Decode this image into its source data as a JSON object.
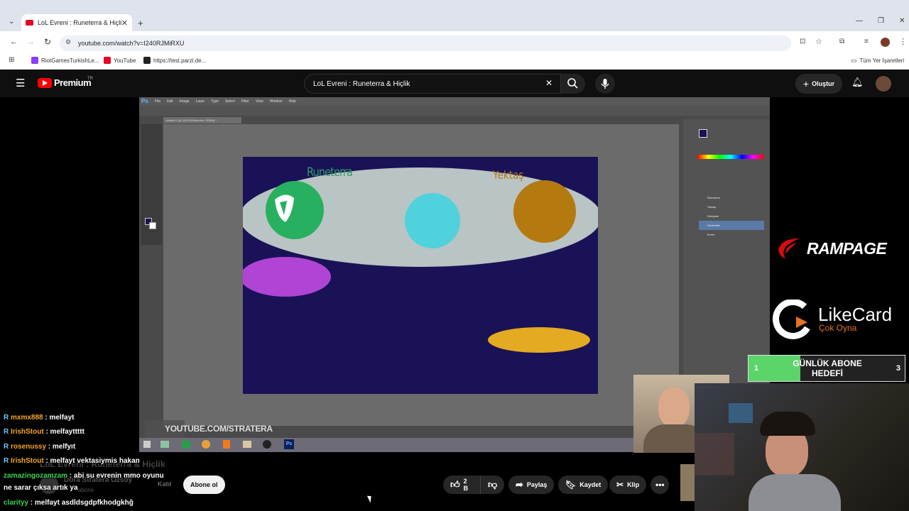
{
  "browser": {
    "tab_title": "LoL Evreni : Runeterra & Hiçlik",
    "url": "youtube.com/watch?v=I240RJMiRXU",
    "bookmarks": [
      "RiotGamesTurkishLe...",
      "YouTube",
      "https://test.parzi.de..."
    ],
    "all_bookmarks_label": "Tüm Yer İşaretleri"
  },
  "youtube": {
    "logo_text": "Premium",
    "region": "TR",
    "search_value": "LoL Evreni : Runeterra & Hiçlik",
    "create_label": "Oluştur"
  },
  "video": {
    "canvas_labels": {
      "runeterra": "Runeterra",
      "yektas": "Yektaş"
    },
    "watermark": "YOUTUBE.COM/STRATERA",
    "ps_menu": [
      "File",
      "Edit",
      "Image",
      "Layer",
      "Type",
      "Select",
      "Filter",
      "View",
      "Window",
      "Help"
    ],
    "ps_doc_tab": "Untitled-1 @ 100% (Düzlemler, RGB/8) *",
    "ps_layers": [
      "Runeterra",
      "Yektaş",
      "Dünyalar",
      "Düzlemler",
      "Evren"
    ],
    "sponsor1": "RAMPAGE",
    "sponsor2": "LikeCard",
    "sponsor2_sub": "Çok Oyna",
    "goal": {
      "left": "1",
      "title": "GÜNLÜK ABONE HEDEFİ",
      "right": "3",
      "progress": 0.33
    },
    "colors": {
      "canvas_bg": "#1a1256",
      "ellipse": "#b9c4c4",
      "green": "#27b05f",
      "cyan": "#4fd2db",
      "brown": "#b47a10",
      "purple": "#b044d4",
      "orange": "#e3aa22"
    }
  },
  "below": {
    "video_title_overlay": "LoL Evreni : Runeterra & Hiçlik",
    "channel": "Dora Stratera Özsoy",
    "channel_sub": "abone",
    "join_label": "Katıl",
    "subscribe_label": "Abone ol",
    "likes": "2 B",
    "share_label": "Paylaş",
    "save_label": "Kaydet",
    "clip_label": "Klip"
  },
  "chat": [
    {
      "user": "mxmx888",
      "msg": " : melfayt",
      "color": "#f5a623"
    },
    {
      "user": "IrishStout",
      "msg": " : melfayttttt",
      "color": "#f5a623"
    },
    {
      "user": "rosenussy",
      "msg": " : melfyıt",
      "color": "#f5a623"
    },
    {
      "user": "IrishStout",
      "msg": " : melfayt vektasiymis hakan",
      "color": "#f5a623"
    },
    {
      "user": "zamazingozamzam",
      "msg": " : abi su evrenin mmo oyunu",
      "color": "#39d353"
    },
    {
      "user": "",
      "msg": "ne sarar çıksa artık ya",
      "color": "#39d353"
    },
    {
      "user": "clarityy",
      "msg": " : melfayt asdldsgdpfkhodgkhğ",
      "color": "#39d353"
    }
  ]
}
